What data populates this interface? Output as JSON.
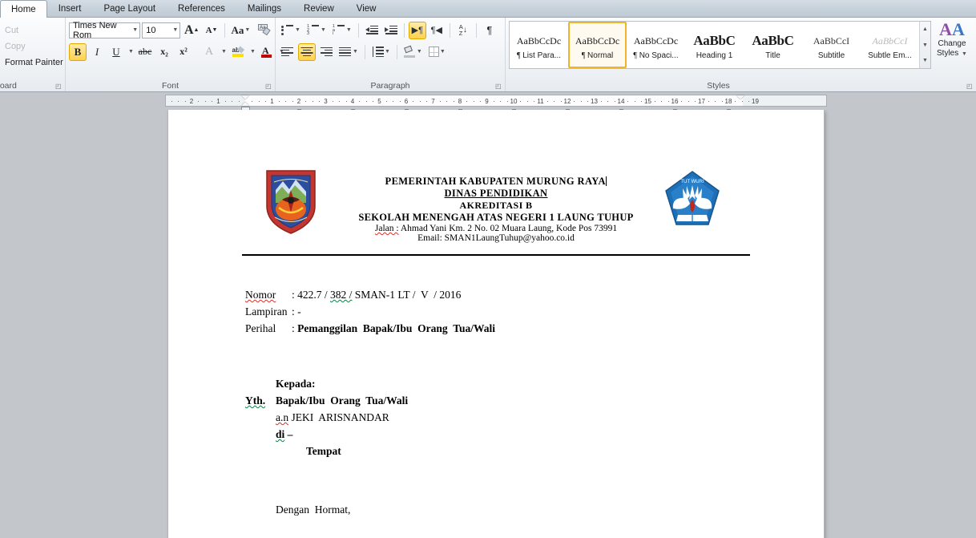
{
  "window": {
    "app": "Microsoft Word"
  },
  "ribbon": {
    "tabs": [
      {
        "label": "Home",
        "active": true
      },
      {
        "label": "Insert",
        "active": false
      },
      {
        "label": "Page Layout",
        "active": false
      },
      {
        "label": "References",
        "active": false
      },
      {
        "label": "Mailings",
        "active": false
      },
      {
        "label": "Review",
        "active": false
      },
      {
        "label": "View",
        "active": false
      }
    ],
    "clipboard": {
      "group_label": "board",
      "items": [
        {
          "label": "Cut",
          "enabled": false
        },
        {
          "label": "Copy",
          "enabled": false
        },
        {
          "label": "Format Painter",
          "enabled": true
        }
      ]
    },
    "font": {
      "group_label": "Font",
      "font_name": "Times New Rom",
      "font_size": "10",
      "grow_font": "A",
      "shrink_font": "A",
      "change_case": "Aa",
      "clear_formatting": "clear-formatting-icon",
      "bold": "B",
      "italic": "I",
      "underline": "U",
      "strikethrough": "abc",
      "subscript": "x₂",
      "superscript": "x²",
      "text_effects": "A",
      "highlight": "ab",
      "font_color": "A",
      "bold_active": true
    },
    "paragraph": {
      "group_label": "Paragraph",
      "bullets": "bullets-icon",
      "numbering": "numbering-icon",
      "multilevel": "multilevel-list-icon",
      "decrease_indent": "decrease-indent-icon",
      "increase_indent": "increase-indent-icon",
      "ltr": "left-to-right-icon",
      "rtl": "right-to-left-icon",
      "sort": "sort-icon",
      "show_marks": "pilcrow-icon",
      "align_left": "align-left-icon",
      "align_center": "align-center-icon",
      "align_right": "align-right-icon",
      "align_justify": "align-justify-icon",
      "line_spacing": "line-spacing-icon",
      "shading": "shading-icon",
      "borders": "borders-icon",
      "ltr_active": true,
      "align_center_active": true
    },
    "styles": {
      "group_label": "Styles",
      "items": [
        {
          "preview": "AaBbCcDc",
          "name": "List Para...",
          "pilcrow": true,
          "kind": "normal",
          "selected": false
        },
        {
          "preview": "AaBbCcDc",
          "name": "Normal",
          "pilcrow": true,
          "kind": "normal",
          "selected": true
        },
        {
          "preview": "AaBbCcDc",
          "name": "No Spaci...",
          "pilcrow": true,
          "kind": "normal",
          "selected": false
        },
        {
          "preview": "AaBbC",
          "name": "Heading 1",
          "pilcrow": false,
          "kind": "h1",
          "selected": false
        },
        {
          "preview": "AaBbC",
          "name": "Title",
          "pilcrow": false,
          "kind": "title",
          "selected": false
        },
        {
          "preview": "AaBbCcI",
          "name": "Subtitle",
          "pilcrow": false,
          "kind": "sub",
          "selected": false
        },
        {
          "preview": "AaBbCcI",
          "name": "Subtle Em...",
          "pilcrow": false,
          "kind": "em",
          "selected": false
        }
      ],
      "change_styles_line1": "Change",
      "change_styles_line2": "Styles",
      "scroll_up": "▲",
      "scroll_down": "▼",
      "scroll_more": "▼"
    }
  },
  "ruler": {
    "unit_labels_left": [
      "2",
      "1"
    ],
    "unit_labels_right": [
      "1",
      "2",
      "3",
      "4",
      "5",
      "6",
      "7",
      "8",
      "9",
      "10",
      "11",
      "12",
      "13",
      "14",
      "15",
      "16",
      "17",
      "18",
      "19"
    ]
  },
  "document": {
    "letterhead": {
      "line1": "PEMERINTAH  KABUPATEN  MURUNG  RAYA",
      "line2": "DINAS  PENDIDIKAN",
      "line3": "AKREDITASI  B",
      "line4": "SEKOLAH  MENENGAH  ATAS NEGERI  1 LAUNG  TUHUP",
      "line5_label": "Jalan :",
      "line5_rest": " Ahmad Yani  Km.  2  No. 02 Muara Laung,  Kode Pos 73991",
      "line6_label": "Email:",
      "line6_rest": "  SMAN1LaungTuhup@yahoo.co.id",
      "logo_left": "murung-raya-regency-crest",
      "logo_right": "tut-wuri-handayani-logo"
    },
    "meta": {
      "nomor_label": "Nomor",
      "nomor_value_a": ": 422.7 / ",
      "nomor_value_b": "382 /",
      "nomor_value_c": " SMAN-1 LT /  V  / 2016",
      "lampiran_label": "Lampiran",
      "lampiran_value": ": -",
      "perihal_label": "Perihal",
      "perihal_colon": ": ",
      "perihal_value": "Pemanggilan  Bapak/Ibu  Orang  Tua/Wali"
    },
    "address": {
      "kepada": "Kepada:",
      "yth": "Yth.",
      "recipient": "Bapak/Ibu  Orang  Tua/Wali",
      "an_label": "a.n",
      "an_name": " JEKI  ARISNANDAR",
      "di": "di",
      "di_dash": " –",
      "tempat": "Tempat"
    },
    "closing": "Dengan  Hormat,"
  }
}
